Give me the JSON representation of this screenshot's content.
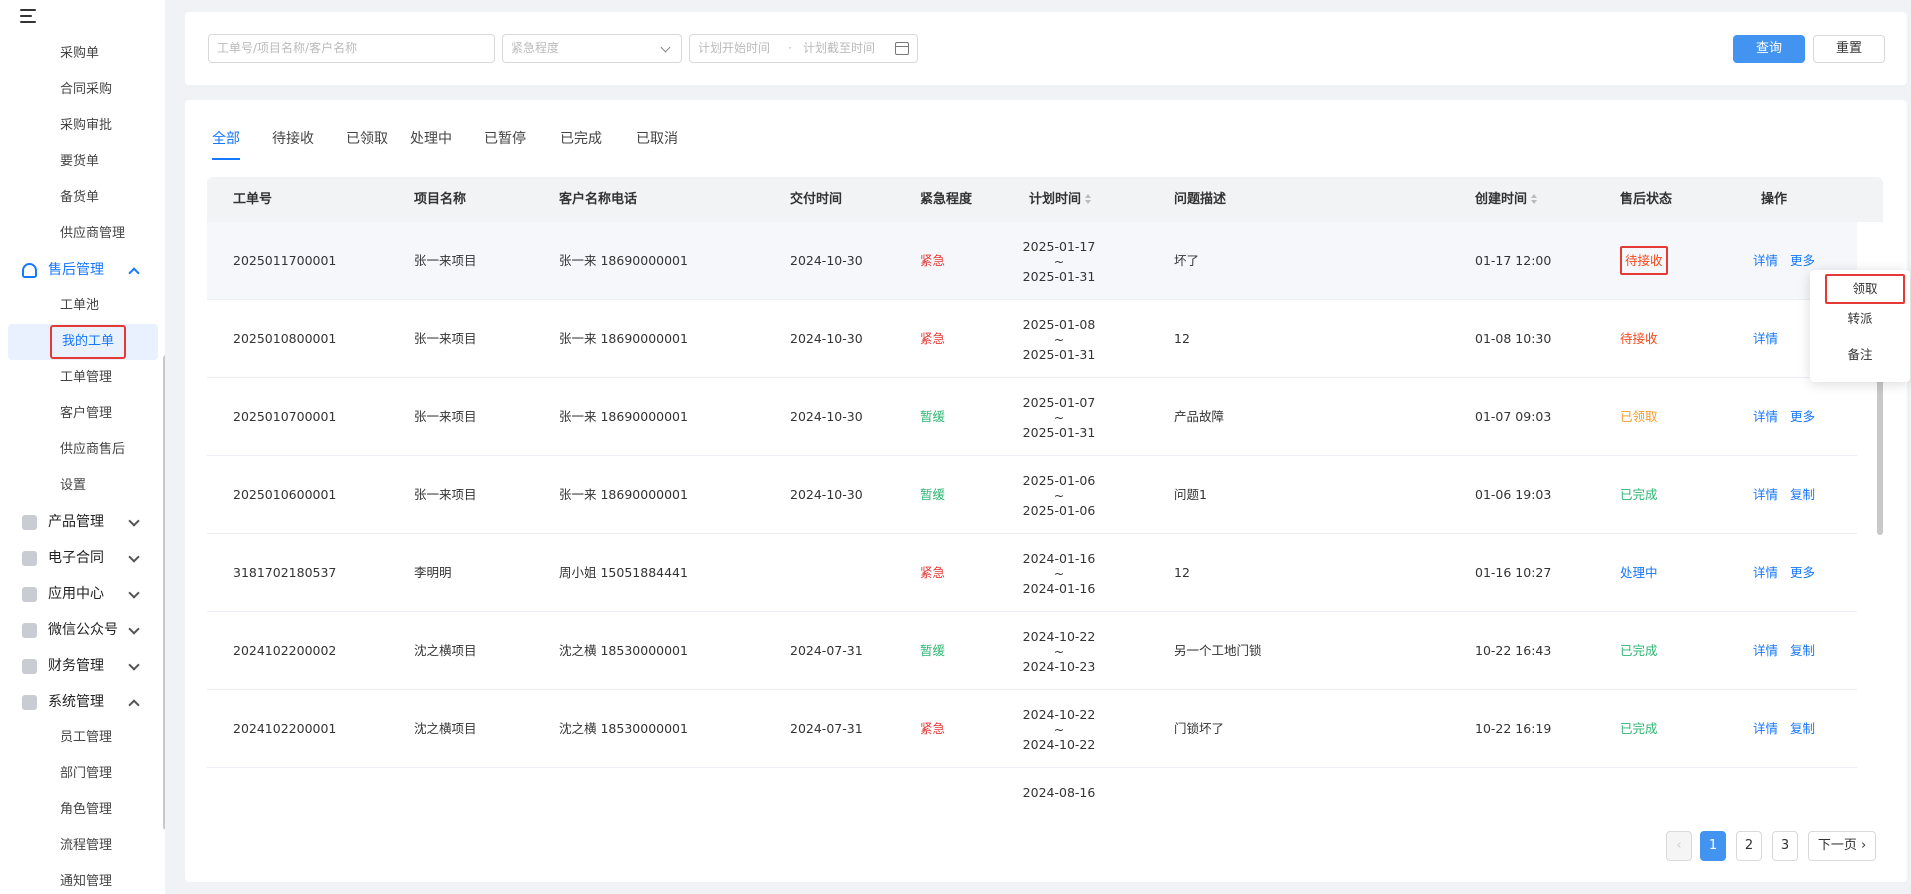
{
  "sidebar": {
    "items_top": [
      "采购单",
      "合同采购",
      "采购审批",
      "要货单",
      "备货单",
      "供应商管理"
    ],
    "aftersales_group": "售后管理",
    "aftersales_items": [
      "工单池",
      "我的工单",
      "工单管理",
      "客户管理",
      "供应商售后",
      "设置"
    ],
    "groups": [
      "产品管理",
      "电子合同",
      "应用中心",
      "微信公众号",
      "财务管理"
    ],
    "system_group": "系统管理",
    "system_items": [
      "员工管理",
      "部门管理",
      "角色管理",
      "流程管理",
      "通知管理"
    ]
  },
  "filter": {
    "keyword_placeholder": "工单号/项目名称/客户名称",
    "urgency_placeholder": "紧急程度",
    "start_placeholder": "计划开始时间",
    "end_placeholder": "计划截至时间",
    "search_label": "查询",
    "reset_label": "重置"
  },
  "tabs": [
    "全部",
    "待接收",
    "已领取",
    "处理中",
    "已暂停",
    "已完成",
    "已取消"
  ],
  "table": {
    "headers": [
      "工单号",
      "项目名称",
      "客户名称电话",
      "交付时间",
      "紧急程度",
      "计划时间",
      "问题描述",
      "创建时间",
      "售后状态",
      "操作"
    ],
    "rows": [
      {
        "no": "2025011700001",
        "project": "张一来项目",
        "customer": "张一来  18690000001",
        "delivery": "2024-10-30",
        "urgency": "紧急",
        "plan_start": "2025-01-17",
        "plan_sep": "~",
        "plan_end": "2025-01-31",
        "desc": "坏了",
        "created": "01-17 12:00",
        "status": "待接收",
        "op1": "详情",
        "op2": "更多"
      },
      {
        "no": "2025010800001",
        "project": "张一来项目",
        "customer": "张一来  18690000001",
        "delivery": "2024-10-30",
        "urgency": "紧急",
        "plan_start": "2025-01-08",
        "plan_sep": "~",
        "plan_end": "2025-01-31",
        "desc": "12",
        "created": "01-08 10:30",
        "status": "待接收",
        "op1": "详情",
        "op2": ""
      },
      {
        "no": "2025010700001",
        "project": "张一来项目",
        "customer": "张一来  18690000001",
        "delivery": "2024-10-30",
        "urgency": "暂缓",
        "plan_start": "2025-01-07",
        "plan_sep": "~",
        "plan_end": "2025-01-31",
        "desc": "产品故障",
        "created": "01-07 09:03",
        "status": "已领取",
        "op1": "详情",
        "op2": "更多"
      },
      {
        "no": "2025010600001",
        "project": "张一来项目",
        "customer": "张一来  18690000001",
        "delivery": "2024-10-30",
        "urgency": "暂缓",
        "plan_start": "2025-01-06",
        "plan_sep": "~",
        "plan_end": "2025-01-06",
        "desc": "问题1",
        "created": "01-06 19:03",
        "status": "已完成",
        "op1": "详情",
        "op2": "复制"
      },
      {
        "no": "3181702180537",
        "project": "李明明",
        "customer": "周小姐  15051884441",
        "delivery": "",
        "urgency": "紧急",
        "plan_start": "2024-01-16",
        "plan_sep": "~",
        "plan_end": "2024-01-16",
        "desc": "12",
        "created": "01-16 10:27",
        "status": "处理中",
        "op1": "详情",
        "op2": "更多"
      },
      {
        "no": "2024102200002",
        "project": "沈之横项目",
        "customer": "沈之横  18530000001",
        "delivery": "2024-07-31",
        "urgency": "暂缓",
        "plan_start": "2024-10-22",
        "plan_sep": "~",
        "plan_end": "2024-10-23",
        "desc": "另一个工地门锁",
        "created": "10-22 16:43",
        "status": "已完成",
        "op1": "详情",
        "op2": "复制"
      },
      {
        "no": "2024102200001",
        "project": "沈之横项目",
        "customer": "沈之横  18530000001",
        "delivery": "2024-07-31",
        "urgency": "紧急",
        "plan_start": "2024-10-22",
        "plan_sep": "~",
        "plan_end": "2024-10-22",
        "desc": "门锁坏了",
        "created": "10-22 16:19",
        "status": "已完成",
        "op1": "详情",
        "op2": "复制"
      },
      {
        "no": "",
        "project": "",
        "customer": "",
        "delivery": "",
        "urgency": "",
        "plan_start": "2024-08-16",
        "plan_sep": "",
        "plan_end": "",
        "desc": "",
        "created": "",
        "status": "",
        "op1": "",
        "op2": ""
      }
    ]
  },
  "dropdown": [
    "领取",
    "转派",
    "备注"
  ],
  "pagination": {
    "pages": [
      "1",
      "2",
      "3"
    ],
    "next": "下一页"
  },
  "colors": {
    "accent": "#4393f0",
    "urgent": "#e53935",
    "slow": "#2fb574",
    "highlight_box": "#e53935"
  }
}
